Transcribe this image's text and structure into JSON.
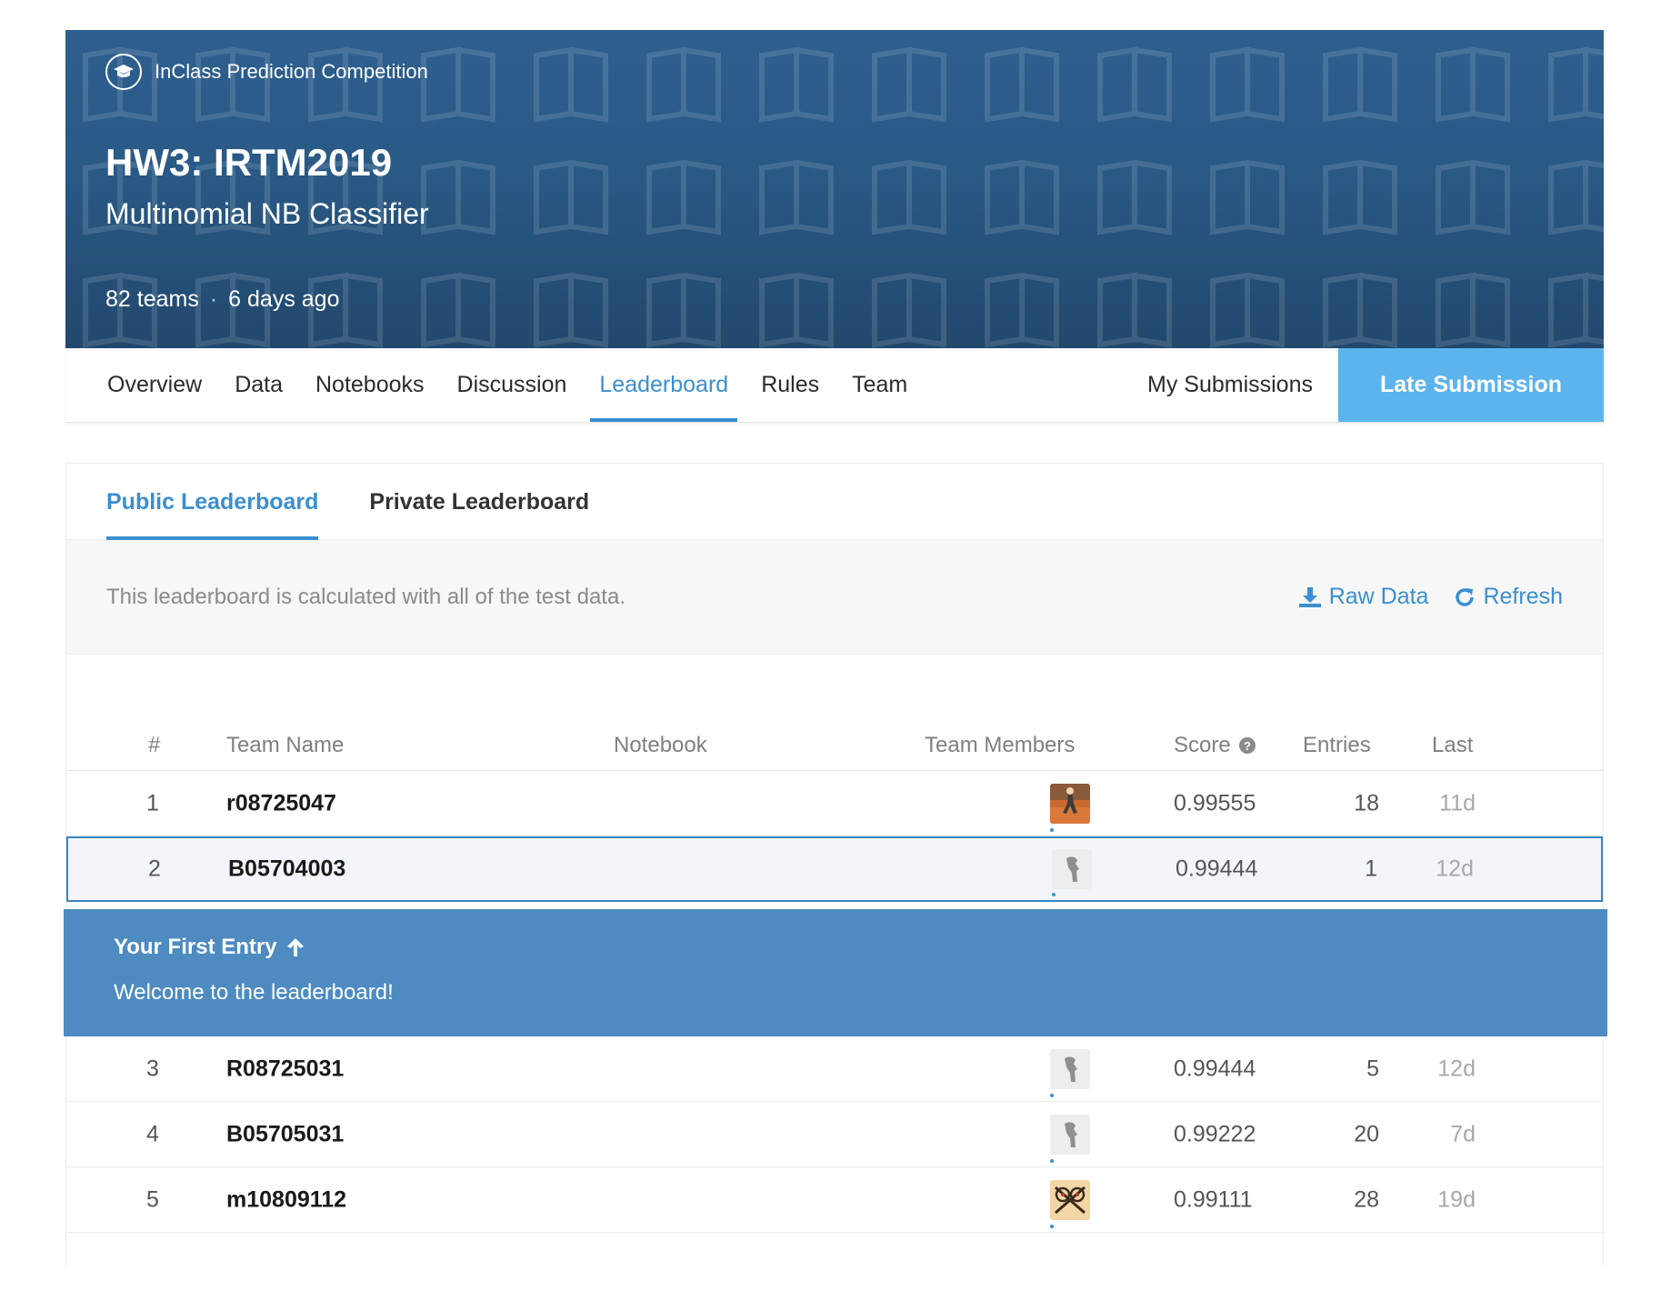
{
  "hero": {
    "badge": "InClass Prediction Competition",
    "title": "HW3: IRTM2019",
    "subtitle": "Multinomial NB Classifier",
    "teams": "82 teams",
    "separator": "·",
    "age": "6 days ago"
  },
  "nav": {
    "tabs": [
      "Overview",
      "Data",
      "Notebooks",
      "Discussion",
      "Leaderboard",
      "Rules",
      "Team"
    ],
    "active": "Leaderboard",
    "my_submissions": "My Submissions",
    "late_submission": "Late Submission"
  },
  "leaderboard": {
    "tabs": [
      "Public Leaderboard",
      "Private Leaderboard"
    ],
    "active_tab": "Public Leaderboard",
    "info": "This leaderboard is calculated with all of the test data.",
    "raw_data": "Raw Data",
    "refresh": "Refresh",
    "columns": {
      "rank": "#",
      "team_name": "Team Name",
      "notebook": "Notebook",
      "team_members": "Team Members",
      "score": "Score",
      "entries": "Entries",
      "last": "Last"
    },
    "rows": [
      {
        "rank": "1",
        "name": "r08725047",
        "score": "0.99555",
        "entries": "18",
        "last": "11d",
        "avatar": "photo-avatar"
      },
      {
        "rank": "2",
        "name": "B05704003",
        "score": "0.99444",
        "entries": "1",
        "last": "12d",
        "avatar": "default-avatar"
      },
      {
        "rank": "3",
        "name": "R08725031",
        "score": "0.99444",
        "entries": "5",
        "last": "12d",
        "avatar": "default-avatar"
      },
      {
        "rank": "4",
        "name": "B05705031",
        "score": "0.99222",
        "entries": "20",
        "last": "7d",
        "avatar": "default-avatar"
      },
      {
        "rank": "5",
        "name": "m10809112",
        "score": "0.99111",
        "entries": "28",
        "last": "19d",
        "avatar": "drawn-avatar"
      }
    ],
    "banner": {
      "title": "Your First Entry",
      "text": "Welcome to the leaderboard!"
    }
  },
  "colors": {
    "hero_bg": "#2e5f8f",
    "accent": "#3a8fd0",
    "late_button": "#5bb4ec",
    "banner_bg": "#4d8bc1"
  }
}
